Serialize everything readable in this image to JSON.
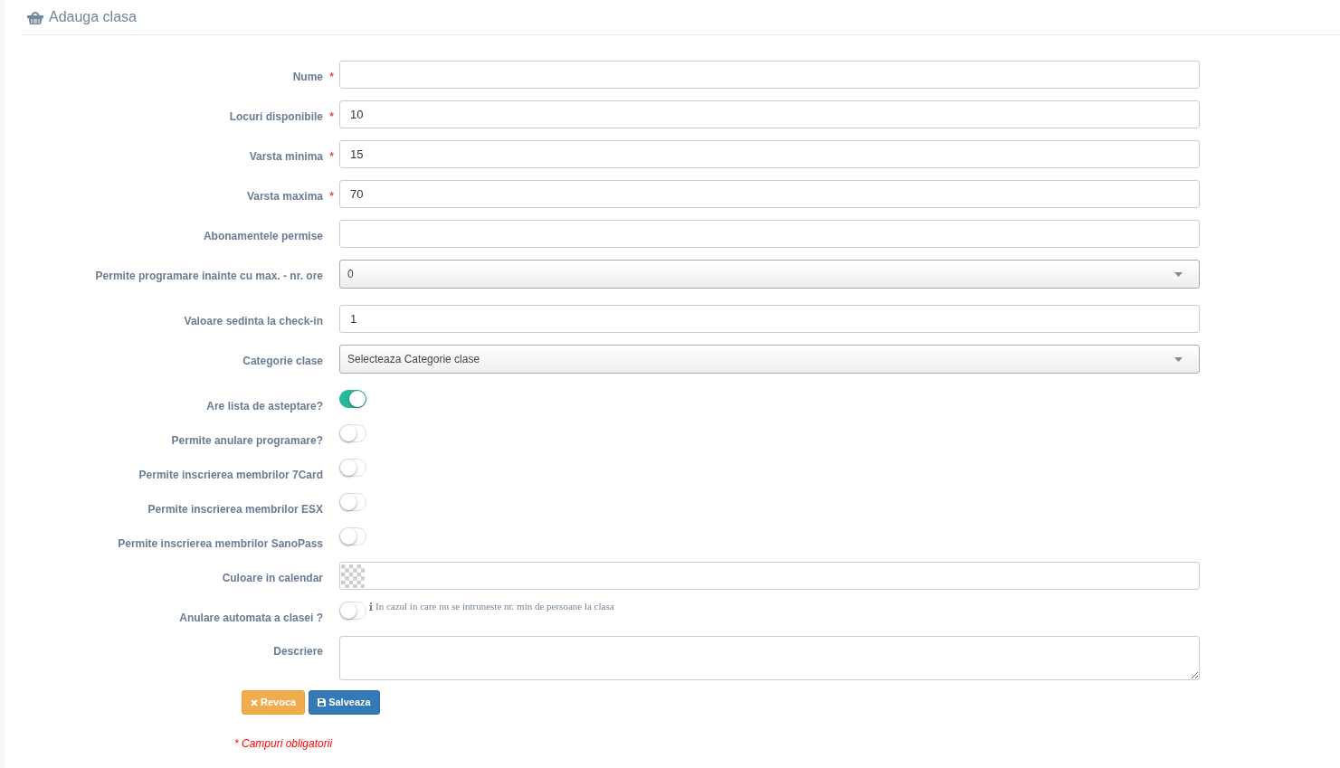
{
  "header": {
    "title": "Adauga clasa"
  },
  "fields": [
    {
      "kind": "text",
      "label": "Nume",
      "required_mark": "*"
    },
    {
      "kind": "text",
      "label": "Locuri disponibile",
      "required_mark": "*",
      "value": "10"
    },
    {
      "kind": "text",
      "label": "Varsta minima",
      "required_mark": "*",
      "value": "15"
    },
    {
      "kind": "text",
      "label": "Varsta maxima",
      "required_mark": "*",
      "value": "70"
    },
    {
      "kind": "text",
      "label": "Abonamentele permise"
    },
    {
      "kind": "select",
      "label": "Permite programare inainte cu max. - nr. ore",
      "value": "0"
    },
    {
      "kind": "text",
      "label": "Valoare sedinta la check-in",
      "value": "1"
    },
    {
      "kind": "select",
      "label": "Categorie clase",
      "value": "Selecteaza Categorie clase"
    },
    {
      "kind": "toggle",
      "label": "Are lista de asteptare?",
      "on": true
    },
    {
      "kind": "toggle",
      "label": "Permite anulare programare?",
      "on": false
    },
    {
      "kind": "toggle",
      "label": "Permite inscrierea membrilor 7Card",
      "on": false
    },
    {
      "kind": "toggle",
      "label": "Permite inscrierea membrilor ESX",
      "on": false
    },
    {
      "kind": "toggle",
      "label": "Permite inscrierea membrilor SanoPass",
      "on": false
    },
    {
      "kind": "color",
      "label": "Culoare in calendar"
    },
    {
      "kind": "toggle",
      "label": "Anulare automata a clasei ?",
      "on": false,
      "note": "In cazul in care nu se intruneste nr. min de persoane la clasa"
    },
    {
      "kind": "textarea",
      "label": "Descriere"
    }
  ],
  "buttons": [
    {
      "kind": "cancel",
      "label": "Revoca"
    },
    {
      "kind": "save",
      "label": "Salveaza"
    }
  ],
  "footnote": "* Campuri obligatorii"
}
